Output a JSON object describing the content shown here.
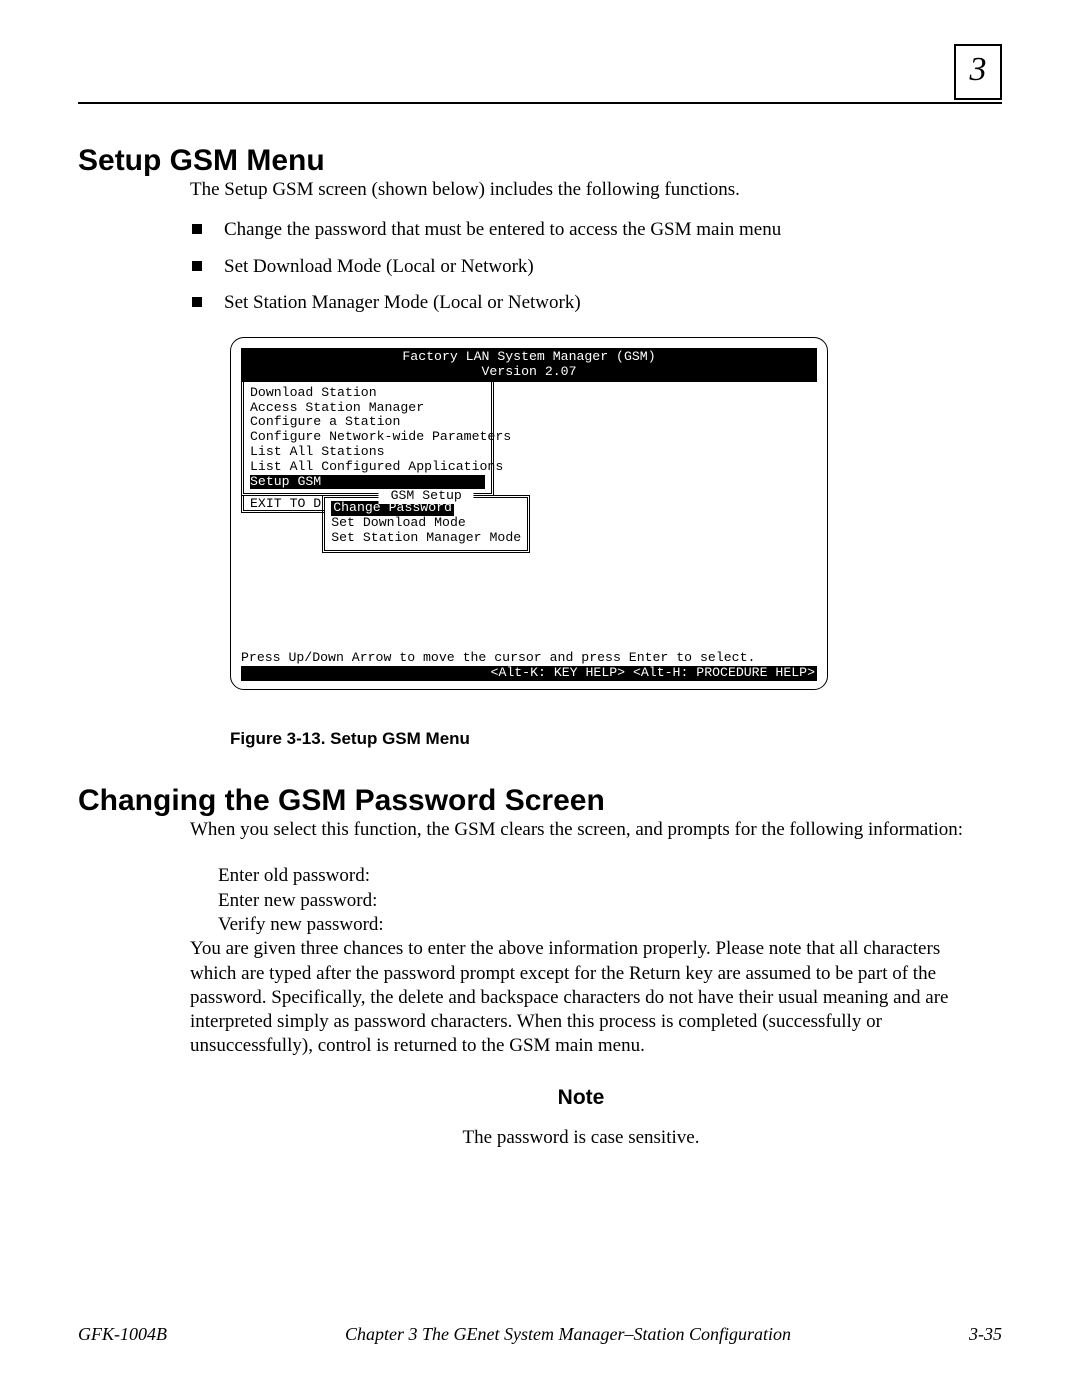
{
  "chapter_number": "3",
  "section1": {
    "heading": "Setup GSM Menu",
    "intro": "The Setup GSM screen (shown below) includes the following functions.",
    "bullets": [
      "Change the password that must be entered to access the GSM main menu",
      "Set Download Mode (Local or Network)",
      "Set Station Manager Mode (Local or Network)"
    ]
  },
  "terminal": {
    "title_line1": "Factory LAN System Manager (GSM)",
    "title_line2": "Version 2.07",
    "menu_items": [
      "Download Station",
      "Access Station Manager",
      "Configure a Station",
      "Configure Network-wide Parameters",
      "List All Stations",
      "List All Configured Applications"
    ],
    "menu_selected": "Setup GSM",
    "exit_label": "EXIT TO D",
    "submenu_title": " GSM Setup ",
    "submenu_selected": "Change Password",
    "submenu_items": [
      "Set Download Mode",
      "Set Station Manager Mode"
    ],
    "help_line": "Press Up/Down Arrow to move the cursor and press Enter to select.",
    "footer_line": "<Alt-K: KEY HELP> <Alt-H: PROCEDURE HELP>"
  },
  "figure_caption": "Figure 3-13.   Setup GSM Menu",
  "section2": {
    "heading": "Changing the GSM Password Screen",
    "intro": "When you select this function, the GSM clears the screen, and prompts for the following information:",
    "prompts": [
      "Enter old password:",
      "Enter new password:",
      "Verify new password:"
    ],
    "para": "You are given three chances to enter the above information properly. Please note that all characters which are typed after the password prompt except for the Return key are assumed to be part of the password.  Specifically, the delete and backspace characters do not have their usual meaning and are interpreted simply as password characters.  When this process is completed (successfully or unsuccessfully), control is returned to the GSM main menu.",
    "note_heading": "Note",
    "note_body": "The password is case sensitive."
  },
  "footer": {
    "left": "GFK-1004B",
    "center": "Chapter 3   The GEnet System Manager–Station   Configuration",
    "right": "3-35"
  }
}
